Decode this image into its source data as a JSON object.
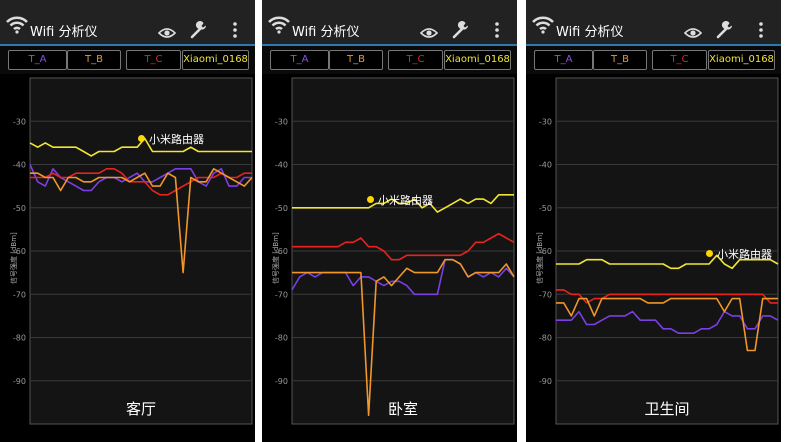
{
  "app_title": "Wifi 分析仪",
  "ylabel": "信号强度 [dBm]",
  "y_ticks": [
    -30,
    -40,
    -50,
    -60,
    -70,
    -80,
    -90
  ],
  "ylim": [
    -100,
    -20
  ],
  "colors": {
    "T_A": "#7b3fe4",
    "T_B": "#f0962a",
    "T_C": "#e8231e",
    "Xiaomi_0168": "#f2e633"
  },
  "tabs": [
    {
      "label": "T_A",
      "color": "#8a4ff0"
    },
    {
      "label": "T_B",
      "color": "#f0962a"
    },
    {
      "label": "T_C",
      "color": "#e8231e"
    },
    {
      "label": "Xiaomi_0168",
      "color": "#f2e633"
    }
  ],
  "legend_label": "小米路由器",
  "chart_data": [
    {
      "type": "line",
      "room": "客厅",
      "ylabel": "信号强度 [dBm]",
      "ylim": [
        -100,
        -20
      ],
      "series": [
        {
          "name": "Xiaomi_0168",
          "color": "#f2e633",
          "values": [
            -35,
            -36,
            -35,
            -36,
            -36,
            -36,
            -36,
            -37,
            -38,
            -37,
            -37,
            -37,
            -36,
            -36,
            -36,
            -34,
            -37,
            -37,
            -37,
            -37,
            -37,
            -36,
            -37,
            -37,
            -37,
            -37,
            -37,
            -37,
            -37,
            -37
          ]
        },
        {
          "name": "T_A",
          "color": "#7b3fe4",
          "values": [
            -40,
            -44,
            -45,
            -41,
            -43,
            -44,
            -45,
            -46,
            -46,
            -44,
            -43,
            -43,
            -44,
            -43,
            -42,
            -44,
            -44,
            -43,
            -42,
            -41,
            -41,
            -41,
            -44,
            -45,
            -42,
            -41,
            -45,
            -45,
            -43,
            -43
          ]
        },
        {
          "name": "T_B",
          "color": "#f0962a",
          "values": [
            -42,
            -42,
            -43,
            -43,
            -46,
            -43,
            -43,
            -44,
            -44,
            -43,
            -43,
            -43,
            -43,
            -44,
            -43,
            -42,
            -45,
            -45,
            -42,
            -43,
            -65,
            -43,
            -44,
            -44,
            -41,
            -42,
            -43,
            -44,
            -45,
            -43
          ]
        },
        {
          "name": "T_C",
          "color": "#e8231e",
          "values": [
            -43,
            -43,
            -43,
            -42,
            -43,
            -43,
            -42,
            -42,
            -42,
            -42,
            -41,
            -41,
            -42,
            -44,
            -44,
            -44,
            -46,
            -47,
            -47,
            -46,
            -45,
            -44,
            -43,
            -43,
            -43,
            -42,
            -43,
            -43,
            -42,
            -42
          ]
        }
      ]
    },
    {
      "type": "line",
      "room": "卧室",
      "ylabel": "信号强度 [dBm]",
      "ylim": [
        -100,
        -20
      ],
      "series": [
        {
          "name": "Xiaomi_0168",
          "color": "#f2e633",
          "values": [
            -50,
            -50,
            -50,
            -50,
            -50,
            -50,
            -50,
            -50,
            -50,
            -50,
            -50,
            -49,
            -49,
            -48,
            -49,
            -49,
            -48,
            -50,
            -49,
            -51,
            -50,
            -49,
            -48,
            -49,
            -48,
            -48,
            -49,
            -47,
            -47,
            -47
          ]
        },
        {
          "name": "T_A",
          "color": "#7b3fe4",
          "values": [
            -69,
            -66,
            -65,
            -66,
            -65,
            -65,
            -65,
            -65,
            -68,
            -66,
            -66,
            -67,
            -68,
            -67,
            -67,
            -68,
            -70,
            -70,
            -70,
            -70,
            -62,
            -62,
            -63,
            -66,
            -65,
            -66,
            -65,
            -66,
            -64,
            -66
          ]
        },
        {
          "name": "T_B",
          "color": "#f0962a",
          "values": [
            -65,
            -65,
            -65,
            -65,
            -65,
            -65,
            -65,
            -65,
            -65,
            -65,
            -98,
            -67,
            -66,
            -68,
            -66,
            -64,
            -65,
            -65,
            -65,
            -65,
            -62,
            -62,
            -63,
            -66,
            -65,
            -65,
            -65,
            -65,
            -63,
            -66
          ]
        },
        {
          "name": "T_C",
          "color": "#e8231e",
          "values": [
            -59,
            -59,
            -59,
            -59,
            -59,
            -59,
            -59,
            -58,
            -58,
            -57,
            -59,
            -59,
            -60,
            -62,
            -62,
            -61,
            -61,
            -61,
            -61,
            -61,
            -61,
            -61,
            -61,
            -60,
            -58,
            -58,
            -57,
            -56,
            -57,
            -58
          ]
        }
      ]
    },
    {
      "type": "line",
      "room": "卫生间",
      "ylabel": "信号强度 [dBm]",
      "ylim": [
        -100,
        -20
      ],
      "series": [
        {
          "name": "Xiaomi_0168",
          "color": "#f2e633",
          "values": [
            -63,
            -63,
            -63,
            -63,
            -62,
            -62,
            -62,
            -63,
            -63,
            -63,
            -63,
            -63,
            -63,
            -63,
            -63,
            -64,
            -64,
            -63,
            -63,
            -63,
            -63,
            -61,
            -63,
            -64,
            -62,
            -62,
            -62,
            -62,
            -62,
            -63
          ]
        },
        {
          "name": "T_A",
          "color": "#7b3fe4",
          "values": [
            -76,
            -76,
            -76,
            -74,
            -77,
            -77,
            -76,
            -75,
            -75,
            -75,
            -74,
            -76,
            -76,
            -76,
            -78,
            -78,
            -79,
            -79,
            -79,
            -78,
            -78,
            -77,
            -74,
            -75,
            -75,
            -78,
            -78,
            -75,
            -75,
            -76
          ]
        },
        {
          "name": "T_B",
          "color": "#f0962a",
          "values": [
            -72,
            -72,
            -75,
            -71,
            -71,
            -75,
            -71,
            -71,
            -71,
            -71,
            -71,
            -71,
            -72,
            -72,
            -72,
            -71,
            -71,
            -71,
            -71,
            -71,
            -71,
            -71,
            -74,
            -71,
            -71,
            -83,
            -83,
            -71,
            -71,
            -71
          ]
        },
        {
          "name": "T_C",
          "color": "#e8231e",
          "values": [
            -69,
            -69,
            -70,
            -70,
            -72,
            -71,
            -71,
            -70,
            -70,
            -70,
            -70,
            -70,
            -70,
            -70,
            -70,
            -70,
            -70,
            -70,
            -70,
            -70,
            -70,
            -70,
            -70,
            -70,
            -70,
            -70,
            -70,
            -70,
            -72,
            -72
          ]
        }
      ]
    }
  ]
}
